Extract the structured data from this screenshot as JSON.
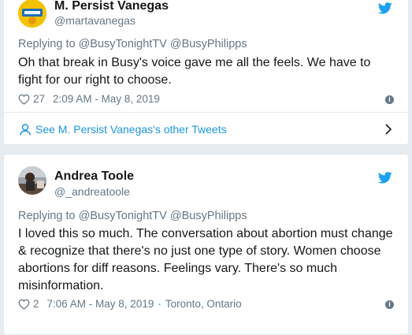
{
  "tweets": [
    {
      "author_name": "M. Persist Vanegas",
      "handle": "@martavanegas",
      "replying_prefix": "Replying to",
      "mentions": [
        "@BusyTonightTV",
        "@BusyPhilipps"
      ],
      "text": "Oh that break in Busy's voice gave me all the feels. We have to\nfight for our right to choose.",
      "likes": "27",
      "time": "2:09 AM - May 8, 2019",
      "see_more": "See M. Persist Vanegas's other Tweets"
    },
    {
      "author_name": "Andrea Toole",
      "handle": "@_andreatoole",
      "replying_prefix": "Replying to",
      "mentions": [
        "@BusyTonightTV",
        "@BusyPhilipps"
      ],
      "text": "I loved this so much. The conversation about abortion must change\n& recognize that there's no just one type of story. Women choose\nabortions for diff reasons. Feelings vary. There's so much\nmisinformation.",
      "likes": "2",
      "time": "7:06 AM - May 8, 2019",
      "location": "Toronto, Ontario"
    }
  ],
  "colors": {
    "background": "#e6ecf0",
    "twitter_blue": "#1da1f2",
    "link_blue": "#1b95e0",
    "secondary_text": "#657786"
  },
  "icons": [
    "twitter-bird-icon",
    "heart-icon",
    "info-icon",
    "person-icon",
    "chevron-right-icon"
  ]
}
